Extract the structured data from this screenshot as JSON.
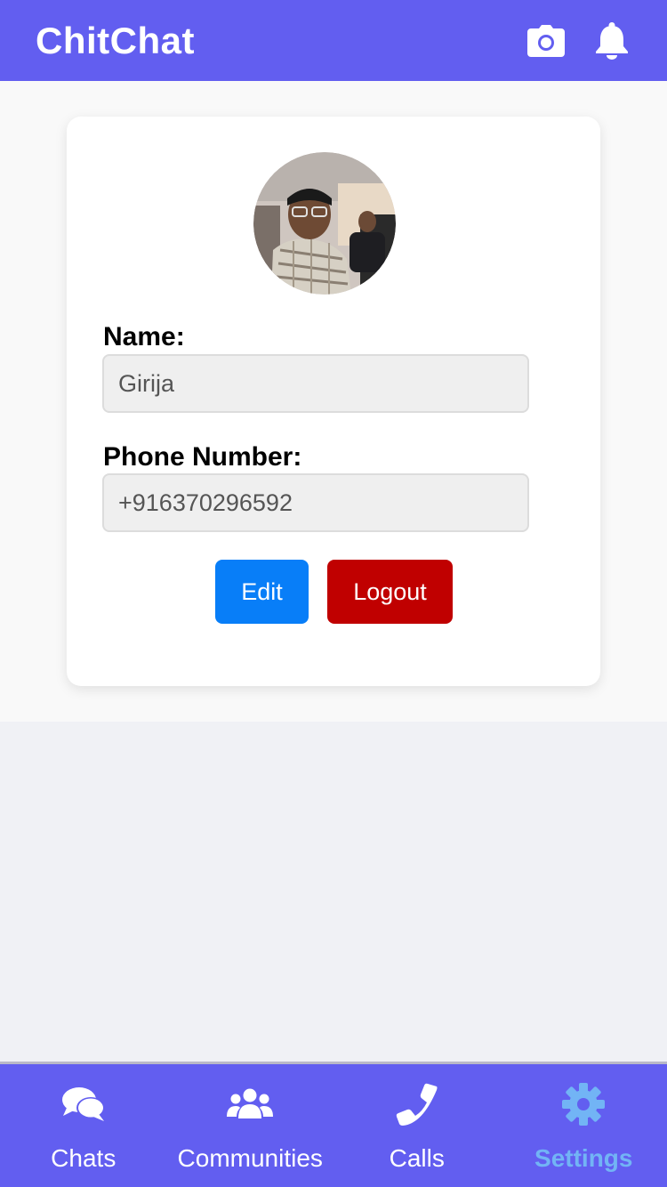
{
  "header": {
    "title": "ChitChat",
    "icons": [
      "camera-icon",
      "bell-icon"
    ]
  },
  "profile": {
    "avatar": "profile-photo",
    "name_label": "Name:",
    "name_value": "Girija",
    "phone_label": "Phone Number:",
    "phone_value": "+916370296592",
    "edit_label": "Edit",
    "logout_label": "Logout"
  },
  "nav": {
    "items": [
      {
        "label": "Chats",
        "icon": "chats-icon",
        "active": false
      },
      {
        "label": "Communities",
        "icon": "communities-icon",
        "active": false
      },
      {
        "label": "Calls",
        "icon": "phone-icon",
        "active": false
      },
      {
        "label": "Settings",
        "icon": "gear-icon",
        "active": true
      }
    ]
  },
  "colors": {
    "primary": "#625ef0",
    "edit_button": "#087ef8",
    "logout_button": "#c00000",
    "active_nav": "#72b4f5"
  }
}
